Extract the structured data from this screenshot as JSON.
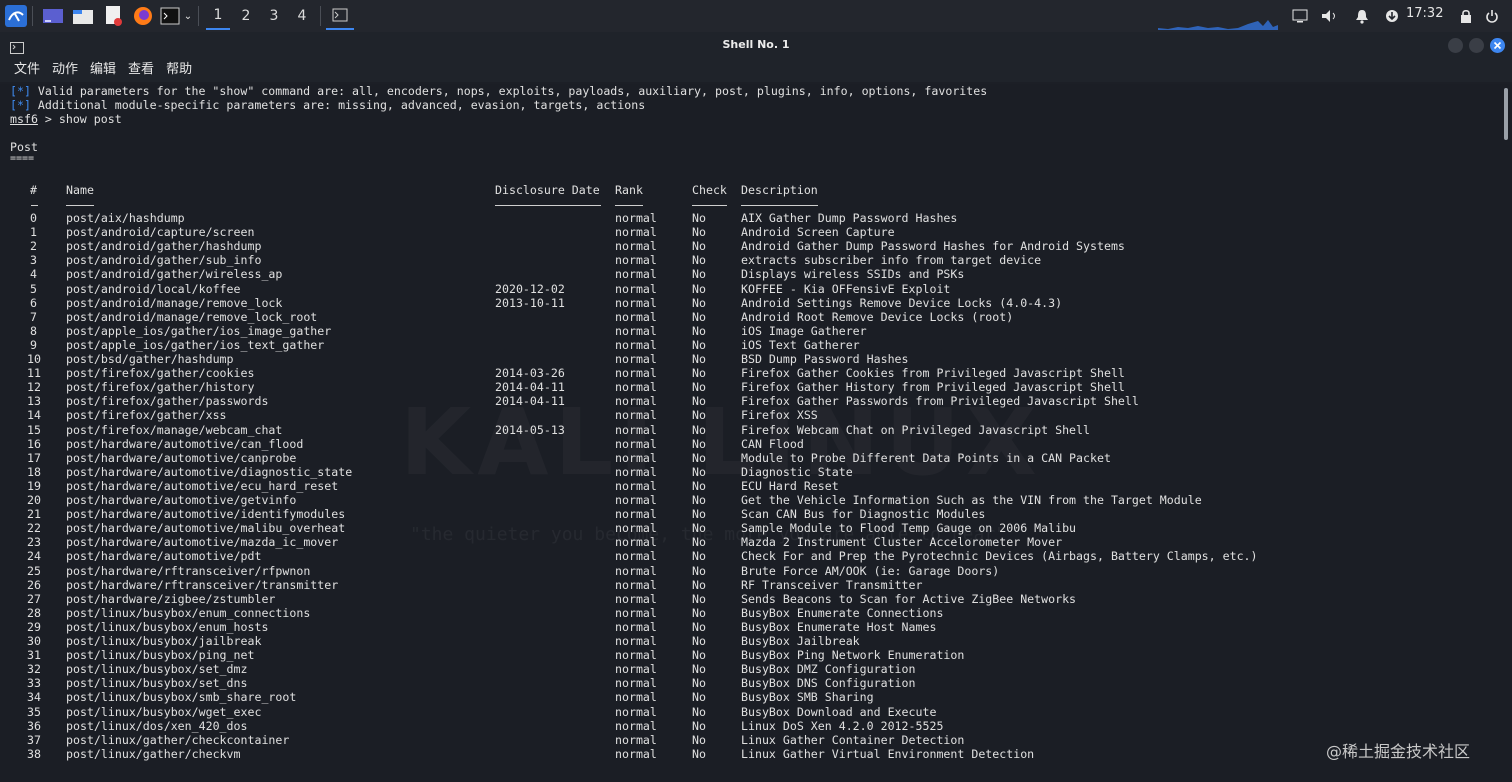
{
  "taskbar": {
    "workspaces": [
      "1",
      "2",
      "3",
      "4"
    ],
    "clock": "17:32"
  },
  "window": {
    "title": "Shell No. 1"
  },
  "menu": [
    "文件",
    "动作",
    "编辑",
    "查看",
    "帮助"
  ],
  "terminal": {
    "info_lines": [
      {
        "prefix": "[*]",
        "text": " Valid parameters for the \"show\" command are: all, encoders, nops, exploits, payloads, auxiliary, post, plugins, info, options, favorites"
      },
      {
        "prefix": "[*]",
        "text": " Additional module-specific parameters are: missing, advanced, evasion, targets, actions"
      }
    ],
    "prompt": "msf6",
    "command": " > show post",
    "section_title": "Post",
    "section_underline": "====",
    "headers": {
      "num": "#",
      "name": "Name",
      "date": "Disclosure Date",
      "rank": "Rank",
      "check": "Check",
      "desc": "Description"
    },
    "rows": [
      [
        "0",
        "post/aix/hashdump",
        "",
        "normal",
        "No",
        "AIX Gather Dump Password Hashes"
      ],
      [
        "1",
        "post/android/capture/screen",
        "",
        "normal",
        "No",
        "Android Screen Capture"
      ],
      [
        "2",
        "post/android/gather/hashdump",
        "",
        "normal",
        "No",
        "Android Gather Dump Password Hashes for Android Systems"
      ],
      [
        "3",
        "post/android/gather/sub_info",
        "",
        "normal",
        "No",
        "extracts subscriber info from target device"
      ],
      [
        "4",
        "post/android/gather/wireless_ap",
        "",
        "normal",
        "No",
        "Displays wireless SSIDs and PSKs"
      ],
      [
        "5",
        "post/android/local/koffee",
        "2020-12-02",
        "normal",
        "No",
        "KOFFEE - Kia OFFensivE Exploit"
      ],
      [
        "6",
        "post/android/manage/remove_lock",
        "2013-10-11",
        "normal",
        "No",
        "Android Settings Remove Device Locks (4.0-4.3)"
      ],
      [
        "7",
        "post/android/manage/remove_lock_root",
        "",
        "normal",
        "No",
        "Android Root Remove Device Locks (root)"
      ],
      [
        "8",
        "post/apple_ios/gather/ios_image_gather",
        "",
        "normal",
        "No",
        "iOS Image Gatherer"
      ],
      [
        "9",
        "post/apple_ios/gather/ios_text_gather",
        "",
        "normal",
        "No",
        "iOS Text Gatherer"
      ],
      [
        "10",
        "post/bsd/gather/hashdump",
        "",
        "normal",
        "No",
        "BSD Dump Password Hashes"
      ],
      [
        "11",
        "post/firefox/gather/cookies",
        "2014-03-26",
        "normal",
        "No",
        "Firefox Gather Cookies from Privileged Javascript Shell"
      ],
      [
        "12",
        "post/firefox/gather/history",
        "2014-04-11",
        "normal",
        "No",
        "Firefox Gather History from Privileged Javascript Shell"
      ],
      [
        "13",
        "post/firefox/gather/passwords",
        "2014-04-11",
        "normal",
        "No",
        "Firefox Gather Passwords from Privileged Javascript Shell"
      ],
      [
        "14",
        "post/firefox/gather/xss",
        "",
        "normal",
        "No",
        "Firefox XSS"
      ],
      [
        "15",
        "post/firefox/manage/webcam_chat",
        "2014-05-13",
        "normal",
        "No",
        "Firefox Webcam Chat on Privileged Javascript Shell"
      ],
      [
        "16",
        "post/hardware/automotive/can_flood",
        "",
        "normal",
        "No",
        "CAN Flood"
      ],
      [
        "17",
        "post/hardware/automotive/canprobe",
        "",
        "normal",
        "No",
        "Module to Probe Different Data Points in a CAN Packet"
      ],
      [
        "18",
        "post/hardware/automotive/diagnostic_state",
        "",
        "normal",
        "No",
        "Diagnostic State"
      ],
      [
        "19",
        "post/hardware/automotive/ecu_hard_reset",
        "",
        "normal",
        "No",
        "ECU Hard Reset"
      ],
      [
        "20",
        "post/hardware/automotive/getvinfo",
        "",
        "normal",
        "No",
        "Get the Vehicle Information Such as the VIN from the Target Module"
      ],
      [
        "21",
        "post/hardware/automotive/identifymodules",
        "",
        "normal",
        "No",
        "Scan CAN Bus for Diagnostic Modules"
      ],
      [
        "22",
        "post/hardware/automotive/malibu_overheat",
        "",
        "normal",
        "No",
        "Sample Module to Flood Temp Gauge on 2006 Malibu"
      ],
      [
        "23",
        "post/hardware/automotive/mazda_ic_mover",
        "",
        "normal",
        "No",
        "Mazda 2 Instrument Cluster Accelorometer Mover"
      ],
      [
        "24",
        "post/hardware/automotive/pdt",
        "",
        "normal",
        "No",
        "Check For and Prep the Pyrotechnic Devices (Airbags, Battery Clamps, etc.)"
      ],
      [
        "25",
        "post/hardware/rftransceiver/rfpwnon",
        "",
        "normal",
        "No",
        "Brute Force AM/OOK (ie: Garage Doors)"
      ],
      [
        "26",
        "post/hardware/rftransceiver/transmitter",
        "",
        "normal",
        "No",
        "RF Transceiver Transmitter"
      ],
      [
        "27",
        "post/hardware/zigbee/zstumbler",
        "",
        "normal",
        "No",
        "Sends Beacons to Scan for Active ZigBee Networks"
      ],
      [
        "28",
        "post/linux/busybox/enum_connections",
        "",
        "normal",
        "No",
        "BusyBox Enumerate Connections"
      ],
      [
        "29",
        "post/linux/busybox/enum_hosts",
        "",
        "normal",
        "No",
        "BusyBox Enumerate Host Names"
      ],
      [
        "30",
        "post/linux/busybox/jailbreak",
        "",
        "normal",
        "No",
        "BusyBox Jailbreak"
      ],
      [
        "31",
        "post/linux/busybox/ping_net",
        "",
        "normal",
        "No",
        "BusyBox Ping Network Enumeration"
      ],
      [
        "32",
        "post/linux/busybox/set_dmz",
        "",
        "normal",
        "No",
        "BusyBox DMZ Configuration"
      ],
      [
        "33",
        "post/linux/busybox/set_dns",
        "",
        "normal",
        "No",
        "BusyBox DNS Configuration"
      ],
      [
        "34",
        "post/linux/busybox/smb_share_root",
        "",
        "normal",
        "No",
        "BusyBox SMB Sharing"
      ],
      [
        "35",
        "post/linux/busybox/wget_exec",
        "",
        "normal",
        "No",
        "BusyBox Download and Execute"
      ],
      [
        "36",
        "post/linux/dos/xen_420_dos",
        "",
        "normal",
        "No",
        "Linux DoS Xen 4.2.0 2012-5525"
      ],
      [
        "37",
        "post/linux/gather/checkcontainer",
        "",
        "normal",
        "No",
        "Linux Gather Container Detection"
      ],
      [
        "38",
        "post/linux/gather/checkvm",
        "",
        "normal",
        "No",
        "Linux Gather Virtual Environment Detection"
      ]
    ]
  },
  "watermark": {
    "logo": "KALI LINUX",
    "slogan": "\"the quieter you become, the more you are able to hear\""
  },
  "credit": "@稀土掘金技术社区",
  "colors": {
    "accent": "#3f8cf1",
    "background": "#1b1e25"
  }
}
